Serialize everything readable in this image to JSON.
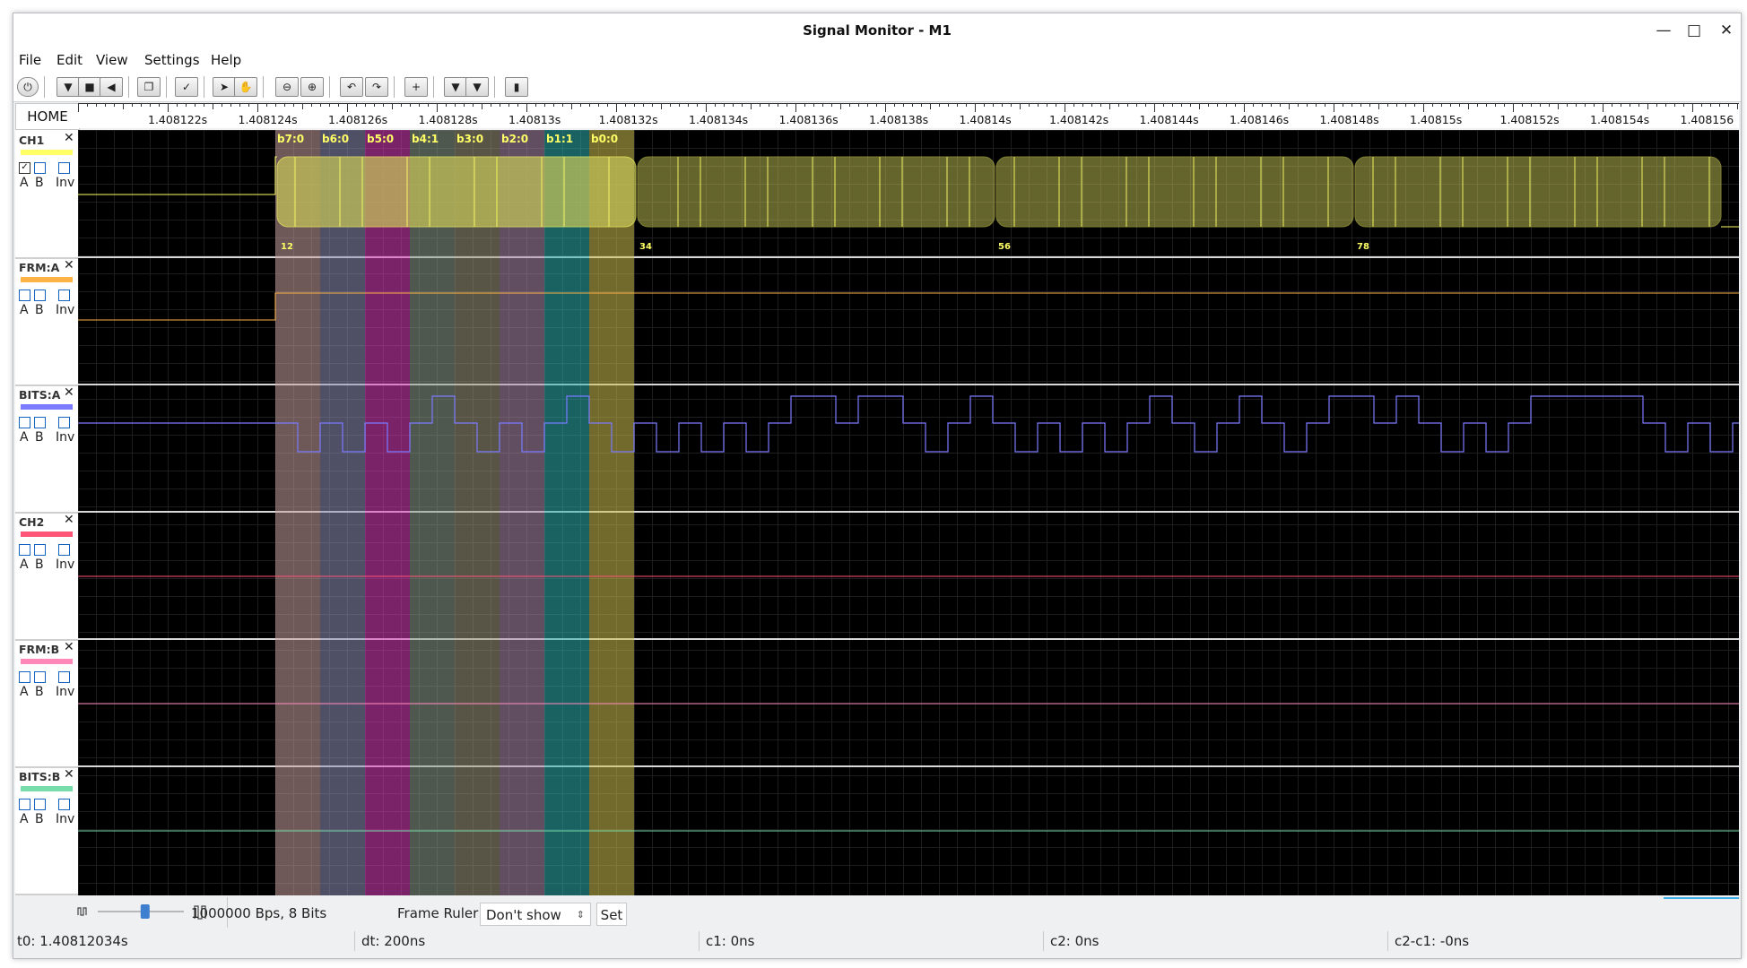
{
  "window": {
    "title": "Signal Monitor - M1"
  },
  "menu": [
    "File",
    "Edit",
    "View",
    "Settings",
    "Help"
  ],
  "toolbar": {
    "buttons": [
      "power",
      "arrow-down",
      "lock",
      "arrow-left",
      "layers",
      "pin",
      "pointer",
      "hand",
      "zoom-out",
      "zoom-in",
      "undo",
      "redo",
      "add",
      "filter",
      "filter-all",
      "capture"
    ]
  },
  "home": "HOME",
  "ruler": {
    "labels": [
      "1.408122s",
      "1.408124s",
      "1.408126s",
      "1.408128s",
      "1.40813s",
      "1.408132s",
      "1.408134s",
      "1.408136s",
      "1.408138s",
      "1.40814s",
      "1.408142s",
      "1.408144s",
      "1.408146s",
      "1.408148s",
      "1.40815s",
      "1.408152s",
      "1.408154s",
      "1.408156"
    ]
  },
  "channels": [
    {
      "name": "CH1",
      "color": "#ffff66",
      "a_checked": true
    },
    {
      "name": "FRM:A",
      "color": "#ffb347",
      "a_checked": false
    },
    {
      "name": "BITS:A",
      "color": "#7b7bff",
      "a_checked": false
    },
    {
      "name": "CH2",
      "color": "#ff5577",
      "a_checked": false
    },
    {
      "name": "FRM:B",
      "color": "#ff88bb",
      "a_checked": false
    },
    {
      "name": "BITS:B",
      "color": "#77ddaa",
      "a_checked": false
    }
  ],
  "channel_labels": {
    "a": "A",
    "b": "B",
    "inv": "Inv"
  },
  "bit_labels": [
    "b7:0",
    "b6:0",
    "b5:0",
    "b4:1",
    "b3:0",
    "b2:0",
    "b1:1",
    "b0:0"
  ],
  "frame_labels": [
    "12",
    "34",
    "56",
    "78"
  ],
  "status": {
    "rate": "1000000 Bps, 8 Bits",
    "frame_ruler_label": "Frame Ruler",
    "frame_ruler_value": "Don't show",
    "set": "Set",
    "slider_level": 0.55
  },
  "readouts": {
    "t0": "t0: 1.40812034s",
    "dt": "dt: 200ns",
    "c1": "c1: 0ns",
    "c2": "c2: 0ns",
    "c2c1": "c2-c1: -0ns"
  }
}
